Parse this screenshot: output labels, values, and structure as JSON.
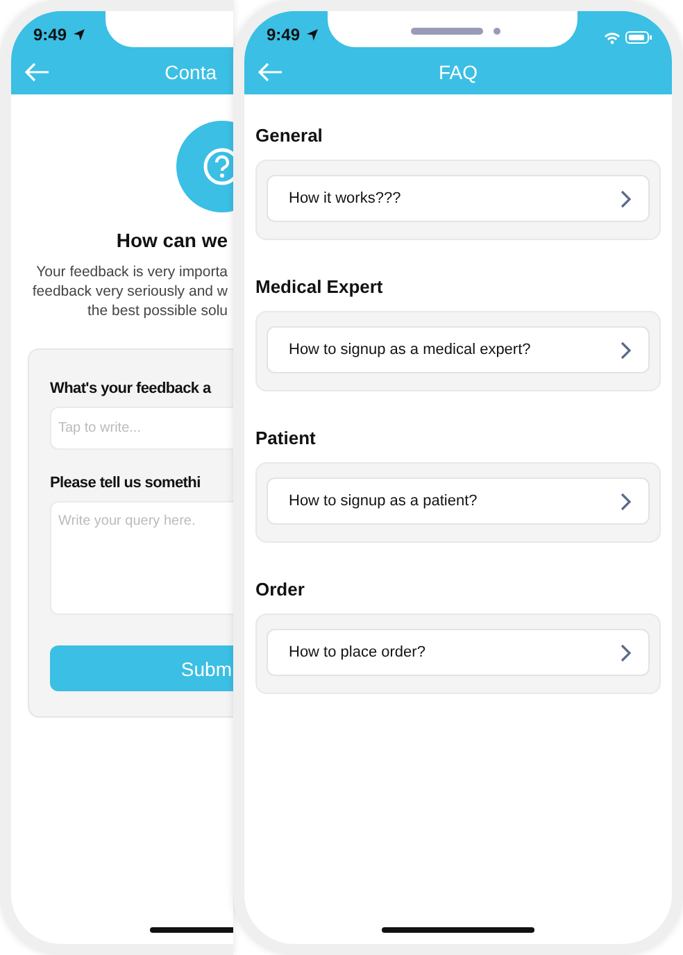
{
  "contact_screen": {
    "status_time": "9:49",
    "title": "Conta",
    "heading": "How can we",
    "description_lines": [
      "Your feedback is very importa",
      "feedback very seriously and w",
      "the best possible solu"
    ],
    "fields": [
      {
        "kind": "line",
        "label": "What's your feedback a",
        "placeholder": "Tap to write..."
      },
      {
        "kind": "area",
        "label": "Please tell us somethi",
        "placeholder": "Write your query here."
      }
    ],
    "submit": "Subm"
  },
  "faq_screen": {
    "status_time": "9:49",
    "title": "FAQ",
    "sections": [
      {
        "heading": "General",
        "questions": [
          "How it works???"
        ]
      },
      {
        "heading": "Medical Expert",
        "questions": [
          "How to signup as a medical expert?"
        ]
      },
      {
        "heading": "Patient",
        "questions": [
          "How to signup as a patient?"
        ]
      },
      {
        "heading": "Order",
        "questions": [
          "How to place order?"
        ]
      }
    ]
  }
}
